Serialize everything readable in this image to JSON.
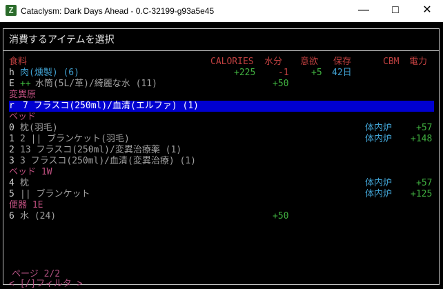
{
  "window": {
    "title": "Cataclysm: Dark Days Ahead - 0.C-32199-g93a5e45",
    "icon": "Z"
  },
  "header": {
    "title": "消費するアイテムを選択"
  },
  "columns": {
    "cat": "食料",
    "calories": "CALORIES",
    "water": "水分",
    "appetite": "意欲",
    "preserve": "保存",
    "cbm": "CBM",
    "power": "電力"
  },
  "rows": [
    {
      "key": "h",
      "name": "肉(燻製) (6)",
      "calories": "+225",
      "water": "-1",
      "appetite": "+5",
      "preserve": "42日"
    },
    {
      "key": "E",
      "prefix": "++",
      "name": " 水筒(5L/革)/綺麗な水 (11)",
      "water": "+50"
    }
  ],
  "mutagen": {
    "label": "変異原",
    "key": "r",
    "name": "7 フラスコ(250ml)/血清(エルファ) (1)"
  },
  "bed": {
    "label": "ベッド",
    "rows": [
      {
        "key": "0",
        "name": "枕(羽毛)",
        "cbm": "体内炉",
        "power": "+57"
      },
      {
        "key": "1",
        "name": "2 || ブランケット(羽毛)",
        "cbm": "体内炉",
        "power": "+148"
      },
      {
        "key": "2",
        "name": "13 フラスコ(250ml)/変異治療薬 (1)"
      },
      {
        "key": "3",
        "name": "3 フラスコ(250ml)/血清(変異治療) (1)"
      }
    ]
  },
  "bed1w": {
    "label": "ベッド 1W",
    "rows": [
      {
        "key": "4",
        "name": "枕",
        "cbm": "体内炉",
        "power": "+57"
      },
      {
        "key": "5",
        "name": "|| ブランケット",
        "cbm": "体内炉",
        "power": "+125"
      }
    ]
  },
  "toilet": {
    "label": "便器 1E",
    "rows": [
      {
        "key": "6",
        "name": "水 (24)",
        "water": "+50"
      }
    ]
  },
  "footer": {
    "page": "ページ 2/2",
    "filter": "< [/]フィルタ >"
  }
}
